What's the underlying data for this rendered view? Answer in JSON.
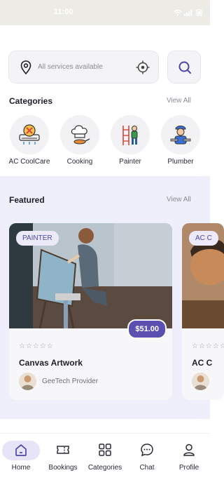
{
  "status_bar": {
    "time": "11:00"
  },
  "search": {
    "placeholder": "All services available"
  },
  "categories": {
    "title": "Categories",
    "view_all": "View All",
    "items": [
      {
        "label": "AC CoolCare",
        "icon": "ac-repair-icon"
      },
      {
        "label": "Cooking",
        "icon": "chef-hat-icon"
      },
      {
        "label": "Painter",
        "icon": "painter-icon"
      },
      {
        "label": "Plumber",
        "icon": "plumber-icon"
      }
    ]
  },
  "featured": {
    "title": "Featured",
    "view_all": "View All",
    "cards": [
      {
        "tag": "PAINTER",
        "price": "$51.00",
        "stars": "☆☆☆☆☆",
        "title": "Canvas Artwork",
        "provider": "GeeTech Provider",
        "rating": 0
      },
      {
        "tag": "AC C",
        "price": "",
        "stars": "☆☆☆☆☆",
        "title": "AC C",
        "provider": "",
        "rating": 0
      }
    ]
  },
  "nav": {
    "items": [
      {
        "label": "Home",
        "icon": "home-icon",
        "active": true
      },
      {
        "label": "Bookings",
        "icon": "ticket-icon",
        "active": false
      },
      {
        "label": "Categories",
        "icon": "grid-icon",
        "active": false
      },
      {
        "label": "Chat",
        "icon": "chat-icon",
        "active": false
      },
      {
        "label": "Profile",
        "icon": "profile-icon",
        "active": false
      }
    ]
  },
  "colors": {
    "accent": "#5b4fb0",
    "featured_bg": "#efeefb",
    "tag_text": "#4b46a8"
  }
}
